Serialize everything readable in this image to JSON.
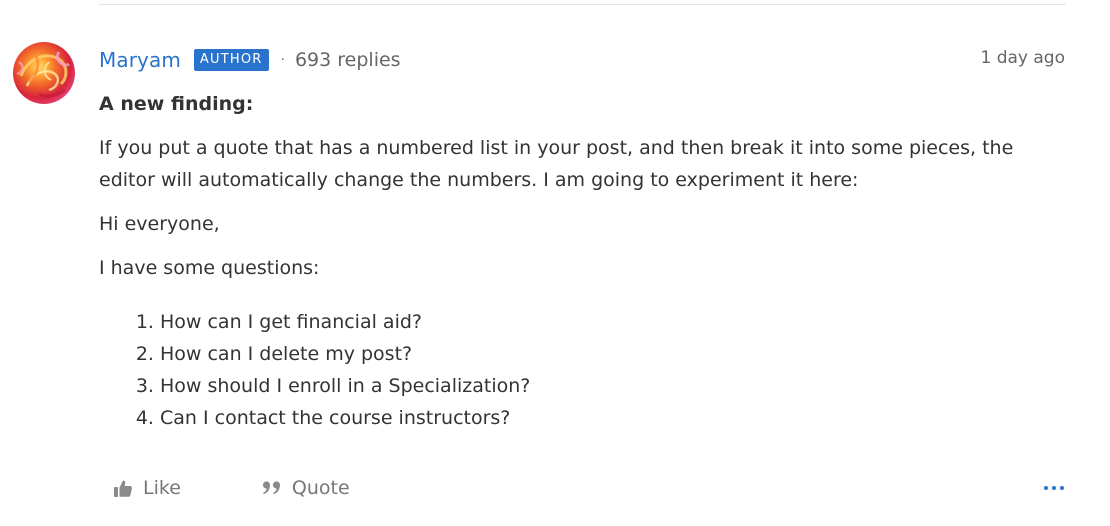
{
  "post": {
    "author": {
      "name": "Maryam",
      "badge": "AUTHOR",
      "avatar": "avatar"
    },
    "separator": "·",
    "replies": "693 replies",
    "timestamp": "1 day ago",
    "content": {
      "heading": "A new finding:",
      "paragraph": "If you put a quote that has a numbered list in your post, and then break it into some pieces, the editor will automatically change the numbers. I am going to experiment it here:",
      "greeting": "Hi everyone,",
      "intro": "I have some questions:",
      "questions": [
        "How can I get financial aid?",
        "How can I delete my post?",
        "How should I enroll in a Specialization?",
        "Can I contact the course instructors?"
      ]
    },
    "actions": {
      "like_label": "Like",
      "like_icon": "thumbs-up-icon",
      "quote_label": "Quote",
      "quote_icon": "quote-icon",
      "more_icon": "more-options-icon"
    }
  },
  "colors": {
    "accent": "#2a73cc",
    "text": "#333333",
    "muted": "#666666"
  }
}
